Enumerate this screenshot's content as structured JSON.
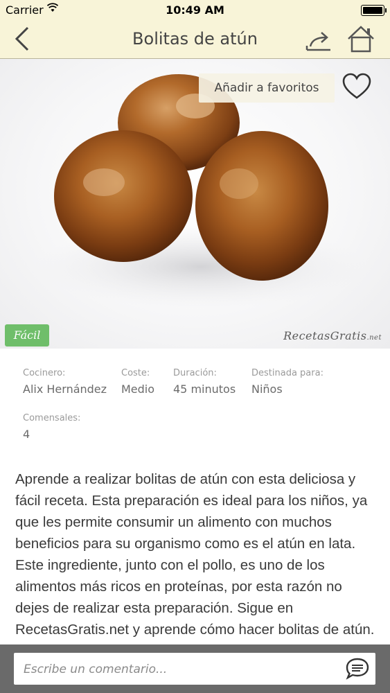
{
  "status_bar": {
    "carrier": "Carrier",
    "time": "10:49 AM"
  },
  "nav": {
    "title": "Bolitas de atún"
  },
  "hero": {
    "favorite_label": "Añadir a favoritos",
    "difficulty_badge": "Fácil",
    "watermark": "RecetasGratis",
    "watermark_suffix": ".net"
  },
  "meta": {
    "cook_label": "Cocinero:",
    "cook_value": "Alix Hernández",
    "cost_label": "Coste:",
    "cost_value": "Medio",
    "duration_label": "Duración:",
    "duration_value": "45 minutos",
    "audience_label": "Destinada para:",
    "audience_value": "Niños",
    "servings_label": "Comensales:",
    "servings_value": "4"
  },
  "description": "Aprende a realizar bolitas de atún con esta deliciosa y fácil receta. Esta preparación es ideal para los niños, ya que les permite consumir un alimento con muchos beneficios para su organismo como es el atún en lata. Este ingrediente, junto con el pollo, es uno de los alimentos más ricos en proteínas, por esta razón no dejes de realizar esta preparación. Sigue en RecetasGratis.net y aprende cómo hacer bolitas de atún.",
  "comment": {
    "placeholder": "Escribe un comentario..."
  },
  "colors": {
    "header_bg": "#f8f4d8",
    "badge_green": "#6fbe6a",
    "comment_bar": "#6a6a6a"
  }
}
